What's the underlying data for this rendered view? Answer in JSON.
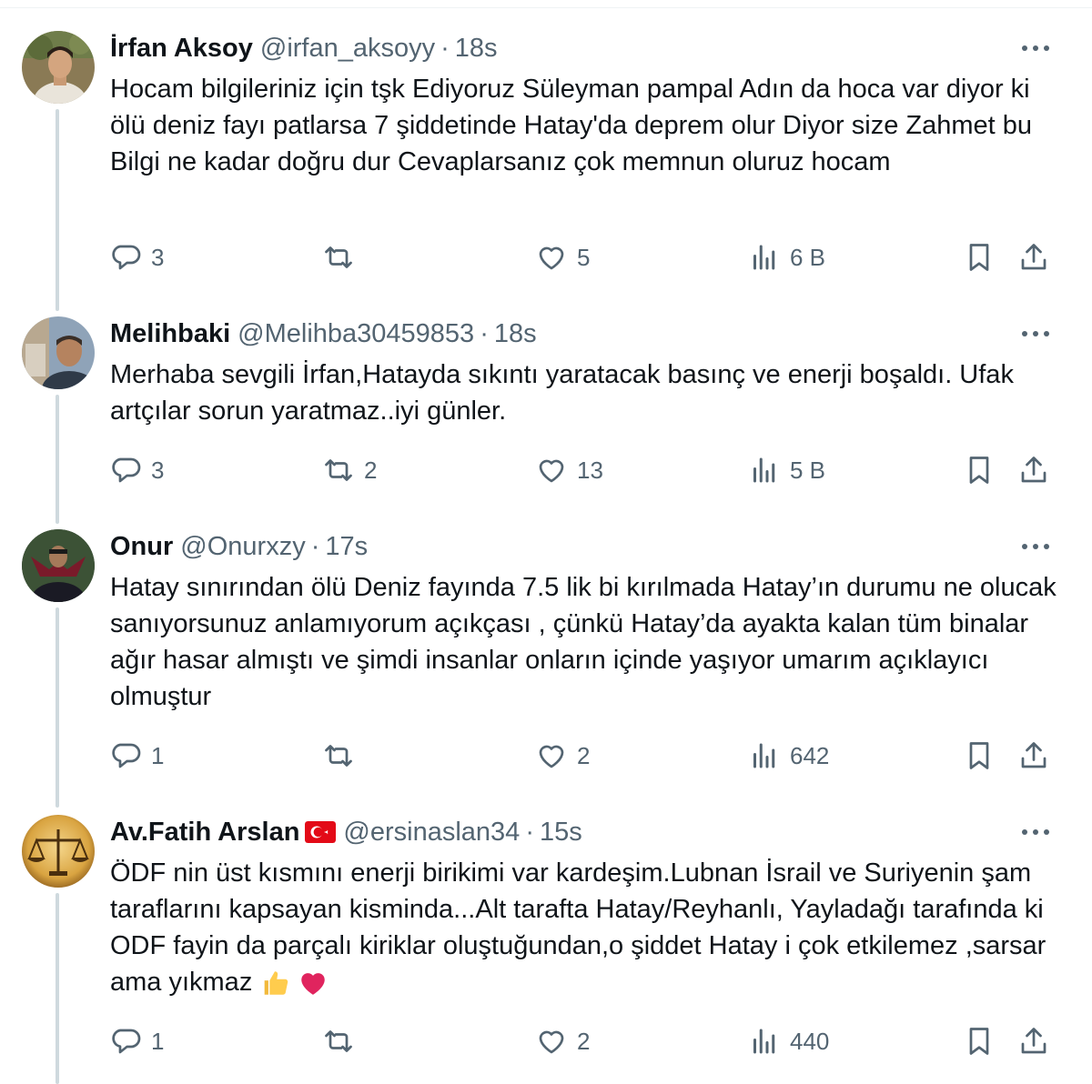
{
  "tweets": [
    {
      "name": "İrfan Aksoy",
      "handle": "@irfan_aksoyy",
      "time": "18s",
      "text": "Hocam bilgileriniz için tşk Ediyoruz Süleyman pampal Adın da hoca var diyor ki ölü deniz fayı patlarsa 7 şiddetinde Hatay'da deprem olur Diyor size Zahmet bu Bilgi ne kadar doğru dur Cevaplarsanız çok memnun oluruz hocam",
      "replies": "3",
      "retweets": "",
      "likes": "5",
      "views": "6 B"
    },
    {
      "name": "Melihbaki",
      "handle": "@Melihba30459853",
      "time": "18s",
      "text": "Merhaba sevgili İrfan,Hatayda sıkıntı yaratacak basınç ve enerji boşaldı. Ufak artçılar sorun yaratmaz..iyi günler.",
      "replies": "3",
      "retweets": "2",
      "likes": "13",
      "views": "5 B"
    },
    {
      "name": "Onur",
      "handle": "@Onurxzy",
      "time": "17s",
      "text": "Hatay sınırından ölü Deniz fayında 7.5 lik bi kırılmada Hatay’ın durumu ne olucak sanıyorsunuz anlamıyorum açıkçası , çünkü Hatay’da ayakta kalan tüm binalar ağır hasar almıştı ve şimdi insanlar onların içinde yaşıyor umarım açıklayıcı olmuştur",
      "replies": "1",
      "retweets": "",
      "likes": "2",
      "views": "642"
    },
    {
      "name": "Av.Fatih Arslan",
      "handle": "@ersinaslan34",
      "time": "15s",
      "text": "ÖDF nin üst kısmını enerji birikimi var kardeşim.Lubnan İsrail ve Suriyenin şam taraflarını kapsayan kisminda...Alt tarafta Hatay/Reyhanlı, Yayladağı tarafında ki ODF fayin da parçalı kiriklar oluştuğundan,o şiddet Hatay i çok etkilemez ,sarsar ama yıkmaz",
      "replies": "1",
      "retweets": "",
      "likes": "2",
      "views": "440"
    }
  ],
  "separator": "·",
  "colors": {
    "text": "#0f1419",
    "secondary": "#536471",
    "thread_line": "#cfd9de",
    "heart_emoji": "#e0245e",
    "flag_red": "#e30a17"
  },
  "icons": [
    "reply-icon",
    "retweet-icon",
    "like-icon",
    "views-icon",
    "bookmark-icon",
    "share-icon",
    "more-icon",
    "thumbs-up-emoji",
    "heart-emoji",
    "turkey-flag"
  ]
}
